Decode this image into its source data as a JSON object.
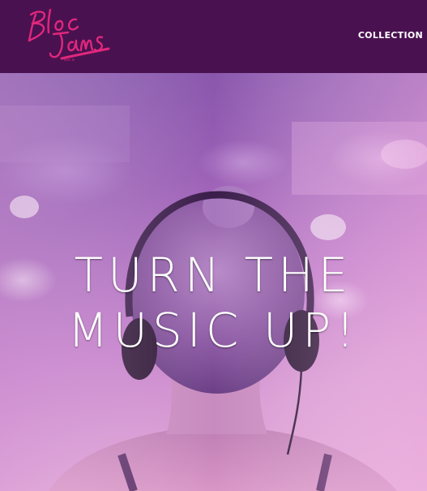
{
  "header": {
    "logo_alt": "Bloc Jams",
    "nav": [
      {
        "label": "COLLECTION"
      }
    ]
  },
  "hero": {
    "title_line1": "TURN THE",
    "title_line2": "MUSIC UP!"
  },
  "colors": {
    "navbar_bg": "#4a1150",
    "logo_pink": "#e0277c",
    "hero_tint": "#b070c0"
  },
  "icons": {
    "logo": "bloc-jams-logo"
  }
}
